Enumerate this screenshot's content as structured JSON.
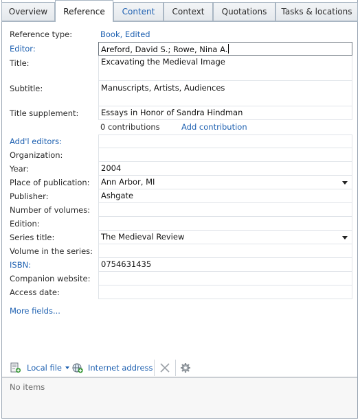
{
  "tabs": [
    {
      "label": "Overview"
    },
    {
      "label": "Reference"
    },
    {
      "label": "Content"
    },
    {
      "label": "Context"
    },
    {
      "label": "Quotations"
    },
    {
      "label": "Tasks & locations"
    }
  ],
  "form": {
    "reference_type": {
      "label": "Reference type:",
      "value": "Book, Edited"
    },
    "editor": {
      "label": "Editor:",
      "value": "Areford, David S.; Rowe, Nina A."
    },
    "title": {
      "label": "Title:",
      "value": "Excavating the Medieval Image"
    },
    "subtitle": {
      "label": "Subtitle:",
      "value": "Manuscripts, Artists, Audiences"
    },
    "title_supplement": {
      "label": "Title supplement:",
      "value": "Essays in Honor of Sandra Hindman"
    },
    "contributions": {
      "count_text": "0 contributions",
      "add_label": "Add contribution"
    },
    "addl_editors": {
      "label": "Add'l editors:",
      "value": ""
    },
    "organization": {
      "label": "Organization:",
      "value": ""
    },
    "year": {
      "label": "Year:",
      "value": "2004"
    },
    "place": {
      "label": "Place of publication:",
      "value": "Ann Arbor, MI"
    },
    "publisher": {
      "label": "Publisher:",
      "value": "Ashgate"
    },
    "num_volumes": {
      "label": "Number of volumes:",
      "value": ""
    },
    "edition": {
      "label": "Edition:",
      "value": ""
    },
    "series_title": {
      "label": "Series title:",
      "value": "The Medieval Review"
    },
    "volume_series": {
      "label": "Volume in the series:",
      "value": ""
    },
    "isbn": {
      "label": "ISBN:",
      "value": "0754631435"
    },
    "companion": {
      "label": "Companion website:",
      "value": ""
    },
    "access_date": {
      "label": "Access date:",
      "value": ""
    },
    "more_fields": "More fields..."
  },
  "toolbar": {
    "local_file": "Local file",
    "internet_address": "Internet address"
  },
  "list": {
    "empty_text": "No items"
  },
  "colors": {
    "link": "#1c5fb0",
    "tab_border": "#a9b6c3"
  }
}
